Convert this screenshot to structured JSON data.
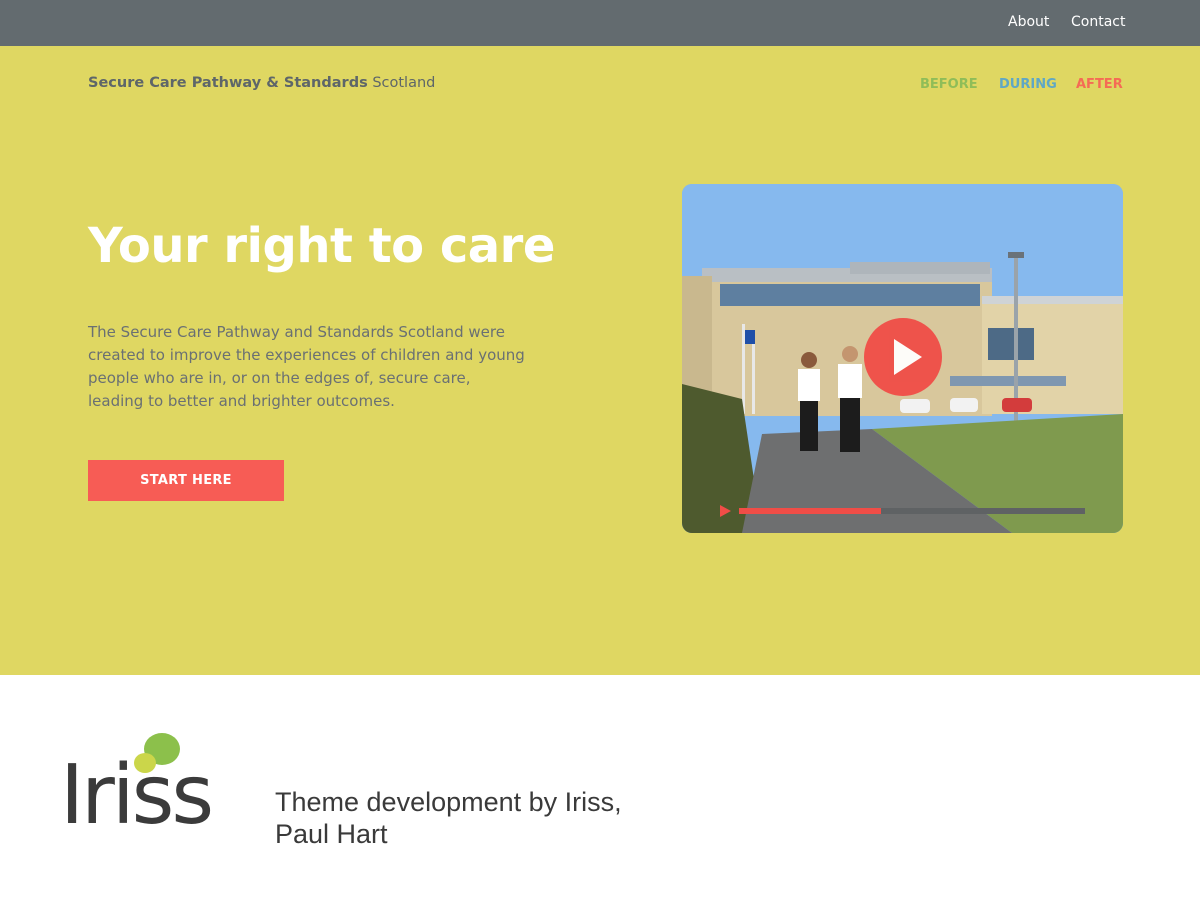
{
  "topbar": {
    "about_label": "About",
    "contact_label": "Contact"
  },
  "hero": {
    "brand_strong": "Secure Care Pathway & Standards",
    "brand_light": "Scotland",
    "phases": {
      "before": "BEFORE",
      "during": "DURING",
      "after": "AFTER"
    },
    "headline": "Your right to care",
    "intro": "The Secure Care Pathway and Standards Scotland were created to improve the experiences of children and young people who are in, or on the edges of, secure care, leading to better and brighter outcomes.",
    "cta_label": "START HERE",
    "video": {
      "play_icon": "play-icon",
      "progress_fraction": 0.41
    }
  },
  "footer": {
    "logo_text": "Iriss",
    "credit": "Theme development by Iriss, Paul Hart"
  },
  "colors": {
    "topbar": "#636b6f",
    "hero_bg": "#dfd762",
    "before": "#8fbd58",
    "during": "#5fa7c5",
    "after": "#f56b55",
    "cta": "#f75c55"
  }
}
